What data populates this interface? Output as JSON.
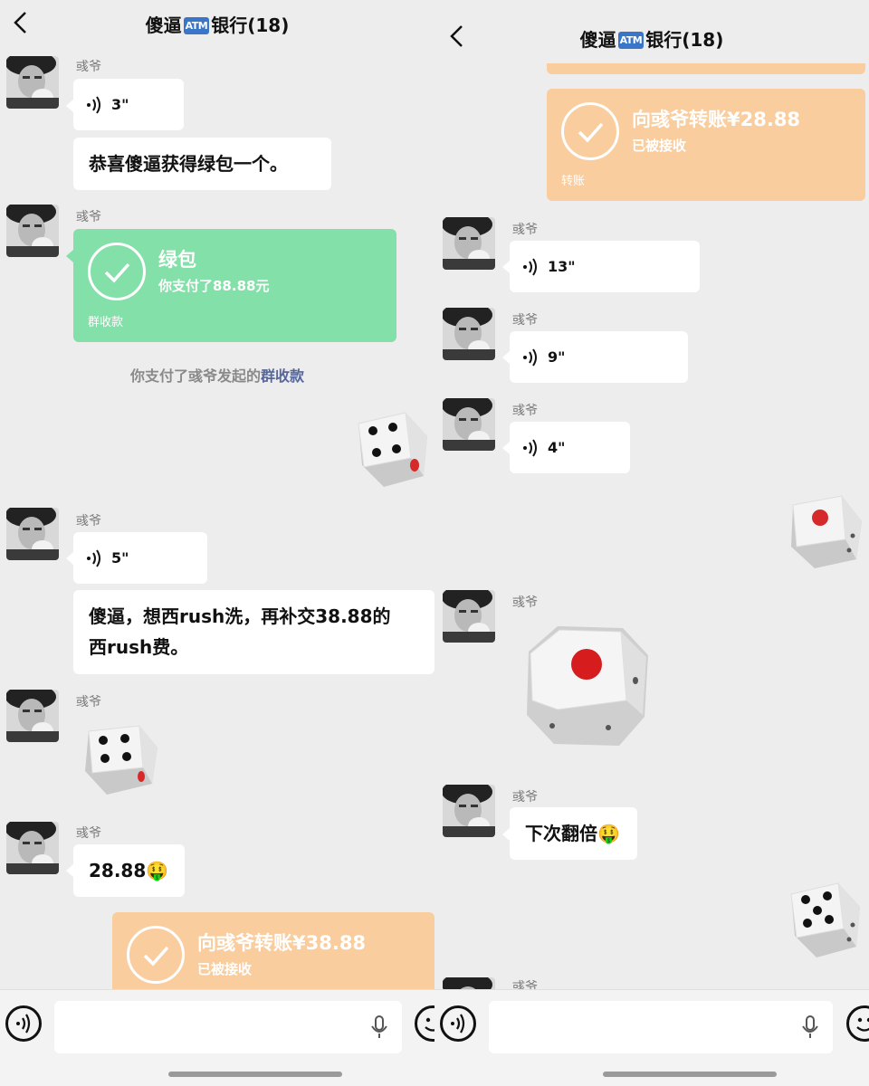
{
  "left": {
    "title_pre": "傻逼",
    "atm": "ATM",
    "title_post": "银行(18)",
    "messages": {
      "m1_sender": "彧爷",
      "m1_voice": "3\"",
      "m1_text": "恭喜傻逼获得绿包一个。",
      "m2_sender": "彧爷",
      "m2_card_title": "绿包",
      "m2_card_sub": "你支付了88.88元",
      "m2_card_foot": "群收款",
      "sys_prefix": "你支付了彧爷发起的",
      "sys_link": "群收款",
      "m3_sender": "彧爷",
      "m3_voice": "5\"",
      "m3_text_line1": "傻逼，想西rush洗，再补交38.88的",
      "m3_text_line2": "西rush费。",
      "m4_sender": "彧爷",
      "m5_sender": "彧爷",
      "m5_text": "28.88🤑",
      "m6_card_title": "向彧爷转账¥38.88",
      "m6_card_sub": "已被接收"
    }
  },
  "right": {
    "title_pre": "傻逼",
    "atm": "ATM",
    "title_post": "银行(18)",
    "messages": {
      "t_card_title": "向彧爷转账¥28.88",
      "t_card_sub": "已被接收",
      "t_card_foot": "转账",
      "r1_sender": "彧爷",
      "r1_voice": "13\"",
      "r2_sender": "彧爷",
      "r2_voice": "9\"",
      "r3_sender": "彧爷",
      "r3_voice": "4\"",
      "r4_sender": "彧爷",
      "r5_sender": "彧爷",
      "r5_text": "下次翻倍🤑",
      "r6_sender": "彧爷"
    }
  },
  "dice": {
    "left_sent_1": 4,
    "left_received": 4,
    "right_sent_1": 1,
    "right_received": 1,
    "right_sent_2": 5
  },
  "colors": {
    "green_card": "#83e0a8",
    "orange_card": "#f9cd9e",
    "link": "#57679a",
    "background": "#ededed"
  },
  "icons": [
    "back-arrow-icon",
    "voice-wave-icon",
    "check-circle-icon",
    "dice-icon",
    "voice-mode-icon",
    "mic-icon",
    "emoji-icon"
  ]
}
